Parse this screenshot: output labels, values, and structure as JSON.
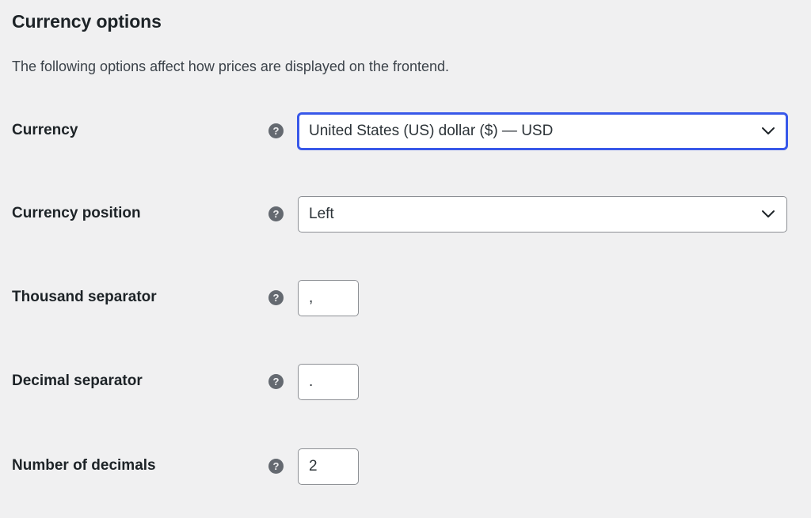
{
  "section": {
    "title": "Currency options",
    "description": "The following options affect how prices are displayed on the frontend."
  },
  "help_glyph": "?",
  "fields": {
    "currency": {
      "label": "Currency",
      "value": "United States (US) dollar ($) — USD",
      "icon": "chevron-down-icon"
    },
    "currency_position": {
      "label": "Currency position",
      "value": "Left",
      "icon": "chevron-down-icon"
    },
    "thousand_separator": {
      "label": "Thousand separator",
      "value": ","
    },
    "decimal_separator": {
      "label": "Decimal separator",
      "value": "."
    },
    "number_of_decimals": {
      "label": "Number of decimals",
      "value": "2"
    }
  },
  "colors": {
    "background": "#f0f0f1",
    "focus_accent": "#3858e9",
    "help_icon": "#646970",
    "input_border": "#8c8f94"
  }
}
